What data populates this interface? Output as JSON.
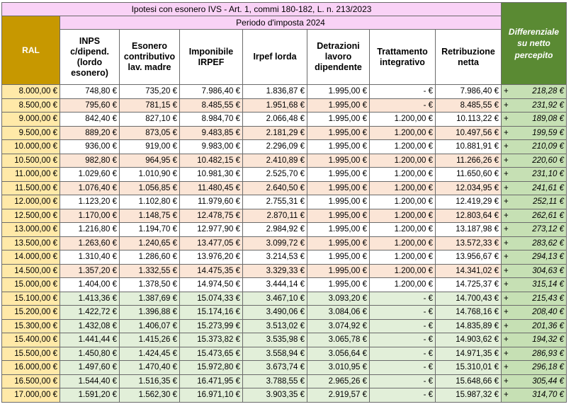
{
  "title": "Ipotesi con esonero IVS - Art. 1, commi 180-182, L. n. 213/2023",
  "period": "Periodo d'imposta 2024",
  "headers": {
    "ral": "RAL",
    "inps": "INPS c/dipend. (lordo esonero)",
    "esonero": "Esonero contributivo lav. madre",
    "imponibile": "Imponibile IRPEF",
    "irpef": "Irpef lorda",
    "detrazioni": "Detrazioni lavoro dipendente",
    "trattamento": "Trattamento integrativo",
    "retribuzione": "Retribuzione netta",
    "differenziale": "Differenziale su netto percepito"
  },
  "colors": {
    "gold": "#c79800",
    "green": "#5a8a33",
    "pink": "#f9d2f6",
    "ral_cell": "#ffe9a8",
    "peach_row": "#fbe5d6",
    "green_row": "#e2efd9",
    "diff_cell": "#c6e0b4"
  },
  "rows": [
    {
      "ral": "8.000,00 €",
      "inps": "748,80 €",
      "esonero": "735,20 €",
      "imponibile": "7.986,40 €",
      "irpef": "1.836,87 €",
      "detrazioni": "1.995,00 €",
      "trattamento": "-   €",
      "netta": "7.986,40 €",
      "diff_sign": "+",
      "diff": "218,28 €"
    },
    {
      "ral": "8.500,00 €",
      "inps": "795,60 €",
      "esonero": "781,15 €",
      "imponibile": "8.485,55 €",
      "irpef": "1.951,68 €",
      "detrazioni": "1.995,00 €",
      "trattamento": "-   €",
      "netta": "8.485,55 €",
      "diff_sign": "+",
      "diff": "231,92 €"
    },
    {
      "ral": "9.000,00 €",
      "inps": "842,40 €",
      "esonero": "827,10 €",
      "imponibile": "8.984,70 €",
      "irpef": "2.066,48 €",
      "detrazioni": "1.995,00 €",
      "trattamento": "1.200,00 €",
      "netta": "10.113,22 €",
      "diff_sign": "+",
      "diff": "189,08 €"
    },
    {
      "ral": "9.500,00 €",
      "inps": "889,20 €",
      "esonero": "873,05 €",
      "imponibile": "9.483,85 €",
      "irpef": "2.181,29 €",
      "detrazioni": "1.995,00 €",
      "trattamento": "1.200,00 €",
      "netta": "10.497,56 €",
      "diff_sign": "+",
      "diff": "199,59 €"
    },
    {
      "ral": "10.000,00 €",
      "inps": "936,00 €",
      "esonero": "919,00 €",
      "imponibile": "9.983,00 €",
      "irpef": "2.296,09 €",
      "detrazioni": "1.995,00 €",
      "trattamento": "1.200,00 €",
      "netta": "10.881,91 €",
      "diff_sign": "+",
      "diff": "210,09 €"
    },
    {
      "ral": "10.500,00 €",
      "inps": "982,80 €",
      "esonero": "964,95 €",
      "imponibile": "10.482,15 €",
      "irpef": "2.410,89 €",
      "detrazioni": "1.995,00 €",
      "trattamento": "1.200,00 €",
      "netta": "11.266,26 €",
      "diff_sign": "+",
      "diff": "220,60 €"
    },
    {
      "ral": "11.000,00 €",
      "inps": "1.029,60 €",
      "esonero": "1.010,90 €",
      "imponibile": "10.981,30 €",
      "irpef": "2.525,70 €",
      "detrazioni": "1.995,00 €",
      "trattamento": "1.200,00 €",
      "netta": "11.650,60 €",
      "diff_sign": "+",
      "diff": "231,10 €"
    },
    {
      "ral": "11.500,00 €",
      "inps": "1.076,40 €",
      "esonero": "1.056,85 €",
      "imponibile": "11.480,45 €",
      "irpef": "2.640,50 €",
      "detrazioni": "1.995,00 €",
      "trattamento": "1.200,00 €",
      "netta": "12.034,95 €",
      "diff_sign": "+",
      "diff": "241,61 €"
    },
    {
      "ral": "12.000,00 €",
      "inps": "1.123,20 €",
      "esonero": "1.102,80 €",
      "imponibile": "11.979,60 €",
      "irpef": "2.755,31 €",
      "detrazioni": "1.995,00 €",
      "trattamento": "1.200,00 €",
      "netta": "12.419,29 €",
      "diff_sign": "+",
      "diff": "252,11 €"
    },
    {
      "ral": "12.500,00 €",
      "inps": "1.170,00 €",
      "esonero": "1.148,75 €",
      "imponibile": "12.478,75 €",
      "irpef": "2.870,11 €",
      "detrazioni": "1.995,00 €",
      "trattamento": "1.200,00 €",
      "netta": "12.803,64 €",
      "diff_sign": "+",
      "diff": "262,61 €"
    },
    {
      "ral": "13.000,00 €",
      "inps": "1.216,80 €",
      "esonero": "1.194,70 €",
      "imponibile": "12.977,90 €",
      "irpef": "2.984,92 €",
      "detrazioni": "1.995,00 €",
      "trattamento": "1.200,00 €",
      "netta": "13.187,98 €",
      "diff_sign": "+",
      "diff": "273,12 €"
    },
    {
      "ral": "13.500,00 €",
      "inps": "1.263,60 €",
      "esonero": "1.240,65 €",
      "imponibile": "13.477,05 €",
      "irpef": "3.099,72 €",
      "detrazioni": "1.995,00 €",
      "trattamento": "1.200,00 €",
      "netta": "13.572,33 €",
      "diff_sign": "+",
      "diff": "283,62 €"
    },
    {
      "ral": "14.000,00 €",
      "inps": "1.310,40 €",
      "esonero": "1.286,60 €",
      "imponibile": "13.976,20 €",
      "irpef": "3.214,53 €",
      "detrazioni": "1.995,00 €",
      "trattamento": "1.200,00 €",
      "netta": "13.956,67 €",
      "diff_sign": "+",
      "diff": "294,13 €"
    },
    {
      "ral": "14.500,00 €",
      "inps": "1.357,20 €",
      "esonero": "1.332,55 €",
      "imponibile": "14.475,35 €",
      "irpef": "3.329,33 €",
      "detrazioni": "1.995,00 €",
      "trattamento": "1.200,00 €",
      "netta": "14.341,02 €",
      "diff_sign": "+",
      "diff": "304,63 €"
    },
    {
      "ral": "15.000,00 €",
      "inps": "1.404,00 €",
      "esonero": "1.378,50 €",
      "imponibile": "14.974,50 €",
      "irpef": "3.444,14 €",
      "detrazioni": "1.995,00 €",
      "trattamento": "1.200,00 €",
      "netta": "14.725,37 €",
      "diff_sign": "+",
      "diff": "315,14 €"
    },
    {
      "ral": "15.100,00 €",
      "inps": "1.413,36 €",
      "esonero": "1.387,69 €",
      "imponibile": "15.074,33 €",
      "irpef": "3.467,10 €",
      "detrazioni": "3.093,20 €",
      "trattamento": "-   €",
      "netta": "14.700,43 €",
      "diff_sign": "+",
      "diff": "215,43 €"
    },
    {
      "ral": "15.200,00 €",
      "inps": "1.422,72 €",
      "esonero": "1.396,88 €",
      "imponibile": "15.174,16 €",
      "irpef": "3.490,06 €",
      "detrazioni": "3.084,06 €",
      "trattamento": "-   €",
      "netta": "14.768,16 €",
      "diff_sign": "+",
      "diff": "208,40 €"
    },
    {
      "ral": "15.300,00 €",
      "inps": "1.432,08 €",
      "esonero": "1.406,07 €",
      "imponibile": "15.273,99 €",
      "irpef": "3.513,02 €",
      "detrazioni": "3.074,92 €",
      "trattamento": "-   €",
      "netta": "14.835,89 €",
      "diff_sign": "+",
      "diff": "201,36 €"
    },
    {
      "ral": "15.400,00 €",
      "inps": "1.441,44 €",
      "esonero": "1.415,26 €",
      "imponibile": "15.373,82 €",
      "irpef": "3.535,98 €",
      "detrazioni": "3.065,78 €",
      "trattamento": "-   €",
      "netta": "14.903,62 €",
      "diff_sign": "+",
      "diff": "194,32 €"
    },
    {
      "ral": "15.500,00 €",
      "inps": "1.450,80 €",
      "esonero": "1.424,45 €",
      "imponibile": "15.473,65 €",
      "irpef": "3.558,94 €",
      "detrazioni": "3.056,64 €",
      "trattamento": "-   €",
      "netta": "14.971,35 €",
      "diff_sign": "+",
      "diff": "286,93 €"
    },
    {
      "ral": "16.000,00 €",
      "inps": "1.497,60 €",
      "esonero": "1.470,40 €",
      "imponibile": "15.972,80 €",
      "irpef": "3.673,74 €",
      "detrazioni": "3.010,95 €",
      "trattamento": "-   €",
      "netta": "15.310,01 €",
      "diff_sign": "+",
      "diff": "296,18 €"
    },
    {
      "ral": "16.500,00 €",
      "inps": "1.544,40 €",
      "esonero": "1.516,35 €",
      "imponibile": "16.471,95 €",
      "irpef": "3.788,55 €",
      "detrazioni": "2.965,26 €",
      "trattamento": "-   €",
      "netta": "15.648,66 €",
      "diff_sign": "+",
      "diff": "305,44 €"
    },
    {
      "ral": "17.000,00 €",
      "inps": "1.591,20 €",
      "esonero": "1.562,30 €",
      "imponibile": "16.971,10 €",
      "irpef": "3.903,35 €",
      "detrazioni": "2.919,57 €",
      "trattamento": "-   €",
      "netta": "15.987,32 €",
      "diff_sign": "+",
      "diff": "314,70 €"
    }
  ]
}
